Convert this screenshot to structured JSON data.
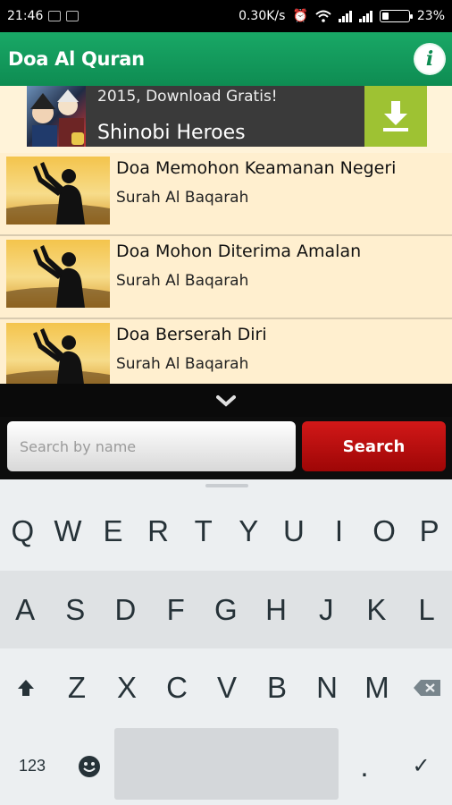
{
  "status": {
    "time": "21:46",
    "net_speed": "0.30K/s",
    "battery": "23%"
  },
  "appbar": {
    "title": "Doa Al Quran",
    "info_icon": "info-icon"
  },
  "ad": {
    "subtitle": "2015, Download Gratis!",
    "title": "Shinobi Heroes",
    "download_icon": "download-icon"
  },
  "list": [
    {
      "title": "Doa Memohon Keamanan Negeri",
      "subtitle": "Surah Al Baqarah"
    },
    {
      "title": "Doa Mohon Diterima Amalan",
      "subtitle": "Surah Al Baqarah"
    },
    {
      "title": "Doa Berserah Diri",
      "subtitle": "Surah Al Baqarah"
    }
  ],
  "search": {
    "placeholder": "Search by name",
    "button_label": "Search"
  },
  "keyboard": {
    "row1": [
      "Q",
      "W",
      "E",
      "R",
      "T",
      "Y",
      "U",
      "I",
      "O",
      "P"
    ],
    "row2": [
      "A",
      "S",
      "D",
      "F",
      "G",
      "H",
      "J",
      "K",
      "L"
    ],
    "row3": [
      "Z",
      "X",
      "C",
      "V",
      "B",
      "N",
      "M"
    ],
    "row4": {
      "numbers": "123",
      "period": ".",
      "done": "✓"
    }
  },
  "colors": {
    "appbar": "#0e8c52",
    "search_button": "#b50b0b",
    "list_bg": "#ffefcf",
    "ad_download": "#9ec233"
  }
}
